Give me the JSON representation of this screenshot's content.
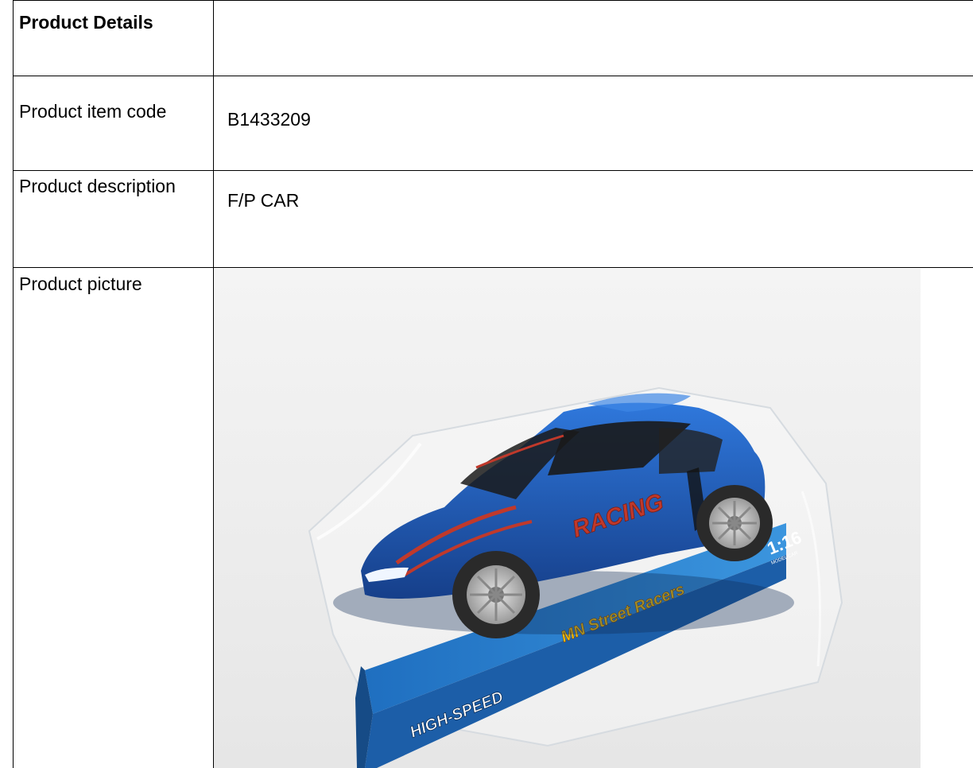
{
  "table": {
    "header": {
      "label": "Product Details",
      "value": ""
    },
    "rows": [
      {
        "label": "Product item code",
        "value": "B1433209"
      },
      {
        "label": "Product description",
        "value": "F/P CAR"
      },
      {
        "label": "Product picture",
        "value": ""
      }
    ]
  },
  "picture": {
    "alt": "Blue toy racing car in clear blister packaging",
    "package_texts": {
      "brand_side": "HIGH-SPEED",
      "series": "MN Street Racers",
      "scale": "1:16",
      "scale_sub": "MODEL CAR",
      "door_decal": "RACING"
    },
    "colors": {
      "car_body": "#1f5fc4",
      "car_shadow": "#163f8a",
      "package_blue": "#2a7fd0",
      "decal_red": "#c0392b",
      "wheel": "#2a2a2a",
      "rim": "#c8c8c8"
    }
  }
}
